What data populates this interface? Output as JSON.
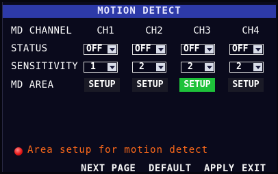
{
  "title": "MOTION DETECT",
  "rows": {
    "channel_label": "MD CHANNEL",
    "status_label": "STATUS",
    "sensitivity_label": "SENSITIVITY",
    "area_label": "MD AREA"
  },
  "channels": [
    {
      "name": "CH1",
      "status": "OFF",
      "sensitivity": "1",
      "area_button": "SETUP",
      "area_selected": false
    },
    {
      "name": "CH2",
      "status": "OFF",
      "sensitivity": "2",
      "area_button": "SETUP",
      "area_selected": false
    },
    {
      "name": "CH3",
      "status": "OFF",
      "sensitivity": "2",
      "area_button": "SETUP",
      "area_selected": true
    },
    {
      "name": "CH4",
      "status": "OFF",
      "sensitivity": "2",
      "area_button": "SETUP",
      "area_selected": false
    }
  ],
  "hint": {
    "icon": "red-dot-icon",
    "text": "Area setup for motion detect"
  },
  "footer": {
    "next_page": "NEXT PAGE",
    "default": "DEFAULT",
    "apply": "APPLY",
    "exit": "EXIT"
  },
  "colors": {
    "title_bar": "#2d3aa8",
    "selected_button": "#1ec23a",
    "hint_text": "#ff6a1a"
  }
}
